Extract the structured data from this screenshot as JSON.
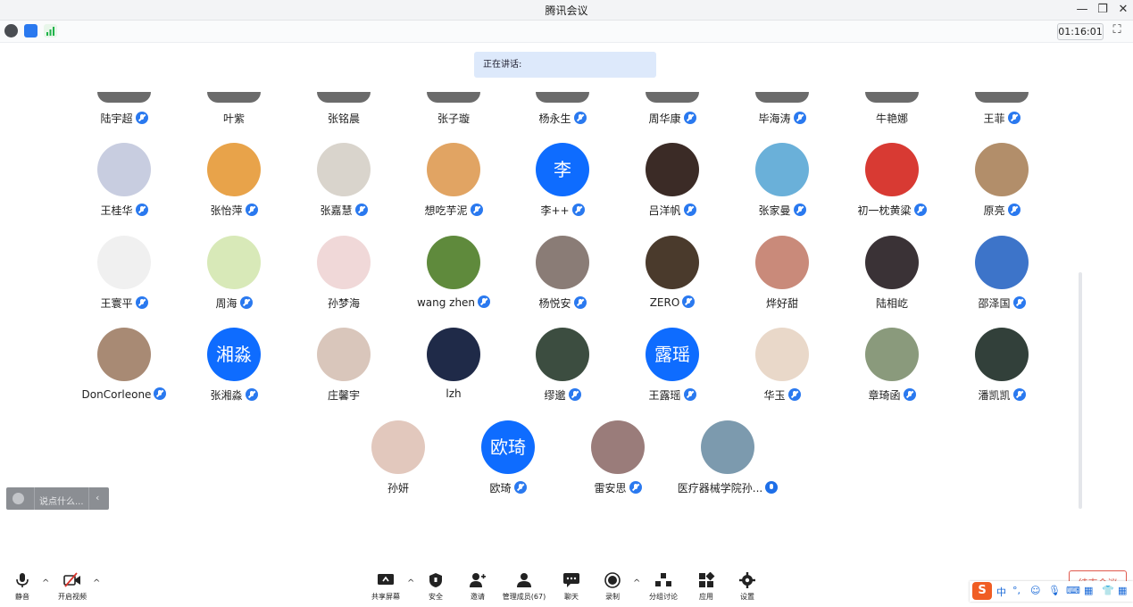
{
  "window": {
    "title": "腾讯会议"
  },
  "timer": "01:16:01",
  "speaking_label": "正在讲话:",
  "partial_row": [
    {
      "name": "陆宇超",
      "mic": "on"
    },
    {
      "name": "叶紫",
      "mic": "none"
    },
    {
      "name": "张铭晨",
      "mic": "none"
    },
    {
      "name": "张子璇",
      "mic": "none"
    },
    {
      "name": "杨永生",
      "mic": "on"
    },
    {
      "name": "周华康",
      "mic": "on"
    },
    {
      "name": "毕海涛",
      "mic": "on"
    },
    {
      "name": "牛艳娜",
      "mic": "none"
    },
    {
      "name": "王菲",
      "mic": "on"
    }
  ],
  "participants": [
    {
      "name": "王桂华",
      "mic": "on",
      "avatar_text": "",
      "color": "#c8cde0"
    },
    {
      "name": "张怡萍",
      "mic": "on",
      "avatar_text": "",
      "color": "#e8a34a"
    },
    {
      "name": "张嘉慧",
      "mic": "on",
      "avatar_text": "",
      "color": "#d9d4cc"
    },
    {
      "name": "想吃芋泥",
      "mic": "on",
      "avatar_text": "",
      "color": "#e1a463"
    },
    {
      "name": "李++",
      "mic": "on",
      "avatar_text": "李",
      "color": "#0e6cff"
    },
    {
      "name": "吕洋帆",
      "mic": "on",
      "avatar_text": "",
      "color": "#3b2b26"
    },
    {
      "name": "张家曼",
      "mic": "on",
      "avatar_text": "",
      "color": "#6ab0d9"
    },
    {
      "name": "初一枕黄粱",
      "mic": "on",
      "avatar_text": "",
      "color": "#d83a33"
    },
    {
      "name": "原亮",
      "mic": "on",
      "avatar_text": "",
      "color": "#b28e6a"
    },
    {
      "name": "王寰平",
      "mic": "on",
      "avatar_text": "",
      "color": "#f0f0f0"
    },
    {
      "name": "周海",
      "mic": "on",
      "avatar_text": "",
      "color": "#d8e9b8"
    },
    {
      "name": "孙梦海",
      "mic": "none",
      "avatar_text": "",
      "color": "#f0d8d8"
    },
    {
      "name": "wang zhen",
      "mic": "on",
      "avatar_text": "",
      "color": "#5f8a3c"
    },
    {
      "name": "杨悦安",
      "mic": "on",
      "avatar_text": "",
      "color": "#8a7c76"
    },
    {
      "name": "ZERO",
      "mic": "on",
      "avatar_text": "",
      "color": "#4a3a2c"
    },
    {
      "name": "烨好甜",
      "mic": "none",
      "avatar_text": "",
      "color": "#c98a7a"
    },
    {
      "name": "陆相屹",
      "mic": "none",
      "avatar_text": "",
      "color": "#3a3236"
    },
    {
      "name": "邵泽国",
      "mic": "on",
      "avatar_text": "",
      "color": "#3d74c9"
    },
    {
      "name": "DonCorleone",
      "mic": "on",
      "avatar_text": "",
      "color": "#a88a74"
    },
    {
      "name": "张湘淼",
      "mic": "on",
      "avatar_text": "湘淼",
      "color": "#0e6cff"
    },
    {
      "name": "庄馨宇",
      "mic": "none",
      "avatar_text": "",
      "color": "#d9c6bb"
    },
    {
      "name": "lzh",
      "mic": "none",
      "avatar_text": "",
      "color": "#1f2a48"
    },
    {
      "name": "缪邈",
      "mic": "on",
      "avatar_text": "",
      "color": "#3c4d40"
    },
    {
      "name": "王露瑶",
      "mic": "on",
      "avatar_text": "露瑶",
      "color": "#0e6cff"
    },
    {
      "name": "华玉",
      "mic": "on",
      "avatar_text": "",
      "color": "#e9d8c9"
    },
    {
      "name": "章琦函",
      "mic": "on",
      "avatar_text": "",
      "color": "#8a9a7c"
    },
    {
      "name": "潘凯凯",
      "mic": "on",
      "avatar_text": "",
      "color": "#32403a"
    }
  ],
  "last_row": [
    {
      "name": "孙妍",
      "mic": "none",
      "avatar_text": "",
      "color": "#e2c8bd"
    },
    {
      "name": "欧琦",
      "mic": "on",
      "avatar_text": "欧琦",
      "color": "#0e6cff"
    },
    {
      "name": "雷安思",
      "mic": "on",
      "avatar_text": "",
      "color": "#9a7c7a"
    },
    {
      "name": "医疗器械学院孙...",
      "mic": "blue",
      "avatar_text": "",
      "color": "#7c9aae"
    }
  ],
  "chat_input": {
    "placeholder": "说点什么..."
  },
  "bottom": {
    "mute": "静音",
    "video": "开启视频",
    "share": "共享屏幕",
    "security": "安全",
    "invite": "邀请",
    "manage": "管理成员(67)",
    "chat": "聊天",
    "record": "录制",
    "breakout": "分组讨论",
    "apps": "应用",
    "settings": "设置",
    "end_meeting": "结束会议"
  },
  "ime": {
    "mode": "中"
  }
}
